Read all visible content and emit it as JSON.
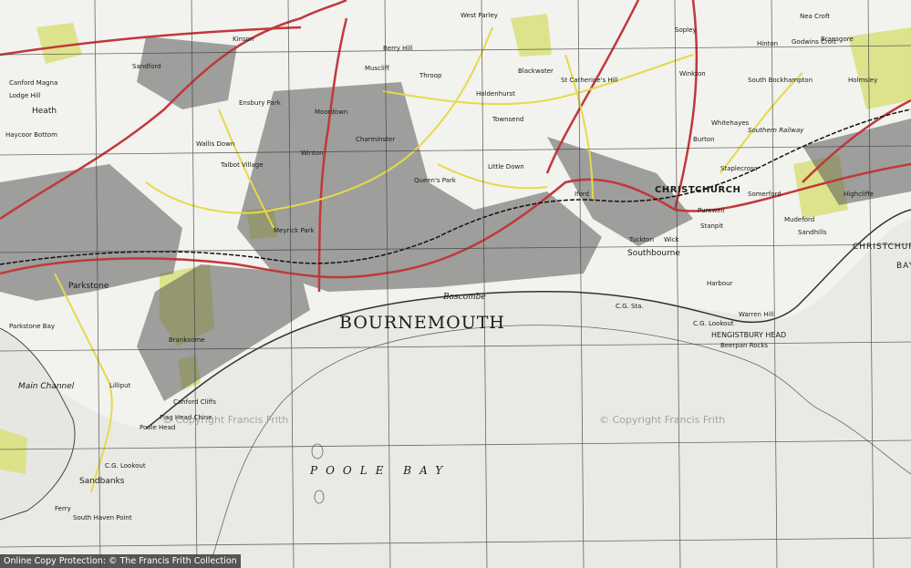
{
  "labels": {
    "bournemouth": "BOURNEMOUTH",
    "poole_bay": "POOLE BAY",
    "christchurch": "CHRISTCHURCH",
    "christchurch_bay": "CHRISTCHURCH",
    "christchurch_bay_2": "BAY",
    "hengistbury": "HENGISTBURY HEAD",
    "boscombe": "Boscombe",
    "southbourne": "Southbourne",
    "parkstone": "Parkstone",
    "sandbanks": "Sandbanks",
    "poole_head": "Poole Head",
    "main_channel": "Main Channel",
    "lilliput": "Lilliput",
    "branksome": "Branksome",
    "tuckton": "Tuckton",
    "iford": "Iford",
    "mudeford": "Mudeford",
    "wick": "Wick",
    "stanpit": "Stanpit",
    "purewell": "Purewell",
    "burton": "Burton",
    "winton": "Winton",
    "queens_park": "Queen's Park",
    "kinson": "Kinson",
    "holdenhurst": "Holdenhurst",
    "somerford": "Somerford",
    "highcliffe": "Highcliffe",
    "bransgore": "Bransgore",
    "sopley": "Sopley",
    "west_parley": "West Parley",
    "heath": "Heath",
    "canford_heath": "Canford Magna",
    "hayes": "Haycoor Bottom",
    "ensbury": "Ensbury Park",
    "wallis_down": "Wallis Down",
    "talbot_village": "Talbot Village",
    "meyrick_park": "Meyrick Park",
    "throop": "Throop",
    "charminster": "Charminster",
    "moordown": "Moordown",
    "muscliff": "Muscliff",
    "berry_hill": "Berry Hill",
    "blackwater": "Blackwater",
    "catherine_hill": "St Catherine's Hill",
    "winkton": "Winkton",
    "whitehayes": "Whitehayes",
    "staplecross": "Staplecross",
    "nea_croft": "Nea Croft",
    "godwins_croft": "Godwins Croft",
    "hinton": "Hinton",
    "bockhampton": "South Bockhampton",
    "hengistbury_small": "Hengistbury Head",
    "harbour": "Harbour",
    "cg_lookout": "C.G. Lookout",
    "cg_lookout_2": "C.G. Lookout",
    "flag_head": "Flag Head Chine",
    "canford_cliffs": "Canford Cliffs",
    "poole_hbr": "Parkstone Bay",
    "ferry": "Ferry",
    "south_haven": "South Haven Point",
    "beerpan": "Beerpan Rocks",
    "warren": "Warren Hill",
    "cg_sta": "C.G. Sta.",
    "little_down": "Little Down",
    "townsend": "Townsend",
    "sandhills": "Sandhills",
    "lodge_hill": "Lodge Hill",
    "holmsley": "Holmsley",
    "southern_railway": "Southern Railway",
    "sandford": "Sandford"
  },
  "watermarks": {
    "center_right": "© Copyright Francis Frith",
    "center_left": "© Copyright Francis Frith"
  },
  "footer": {
    "text": "Online Copy Protection: © The Francis Frith Collection"
  },
  "colors": {
    "land": "#f2f2ee",
    "sea": "#e6e6e2",
    "urban": "#2a2a2a",
    "road_main": "#c0393b",
    "road_secondary": "#e6d94a",
    "green": "#d8e07a",
    "grid": "#3a3a3a"
  }
}
